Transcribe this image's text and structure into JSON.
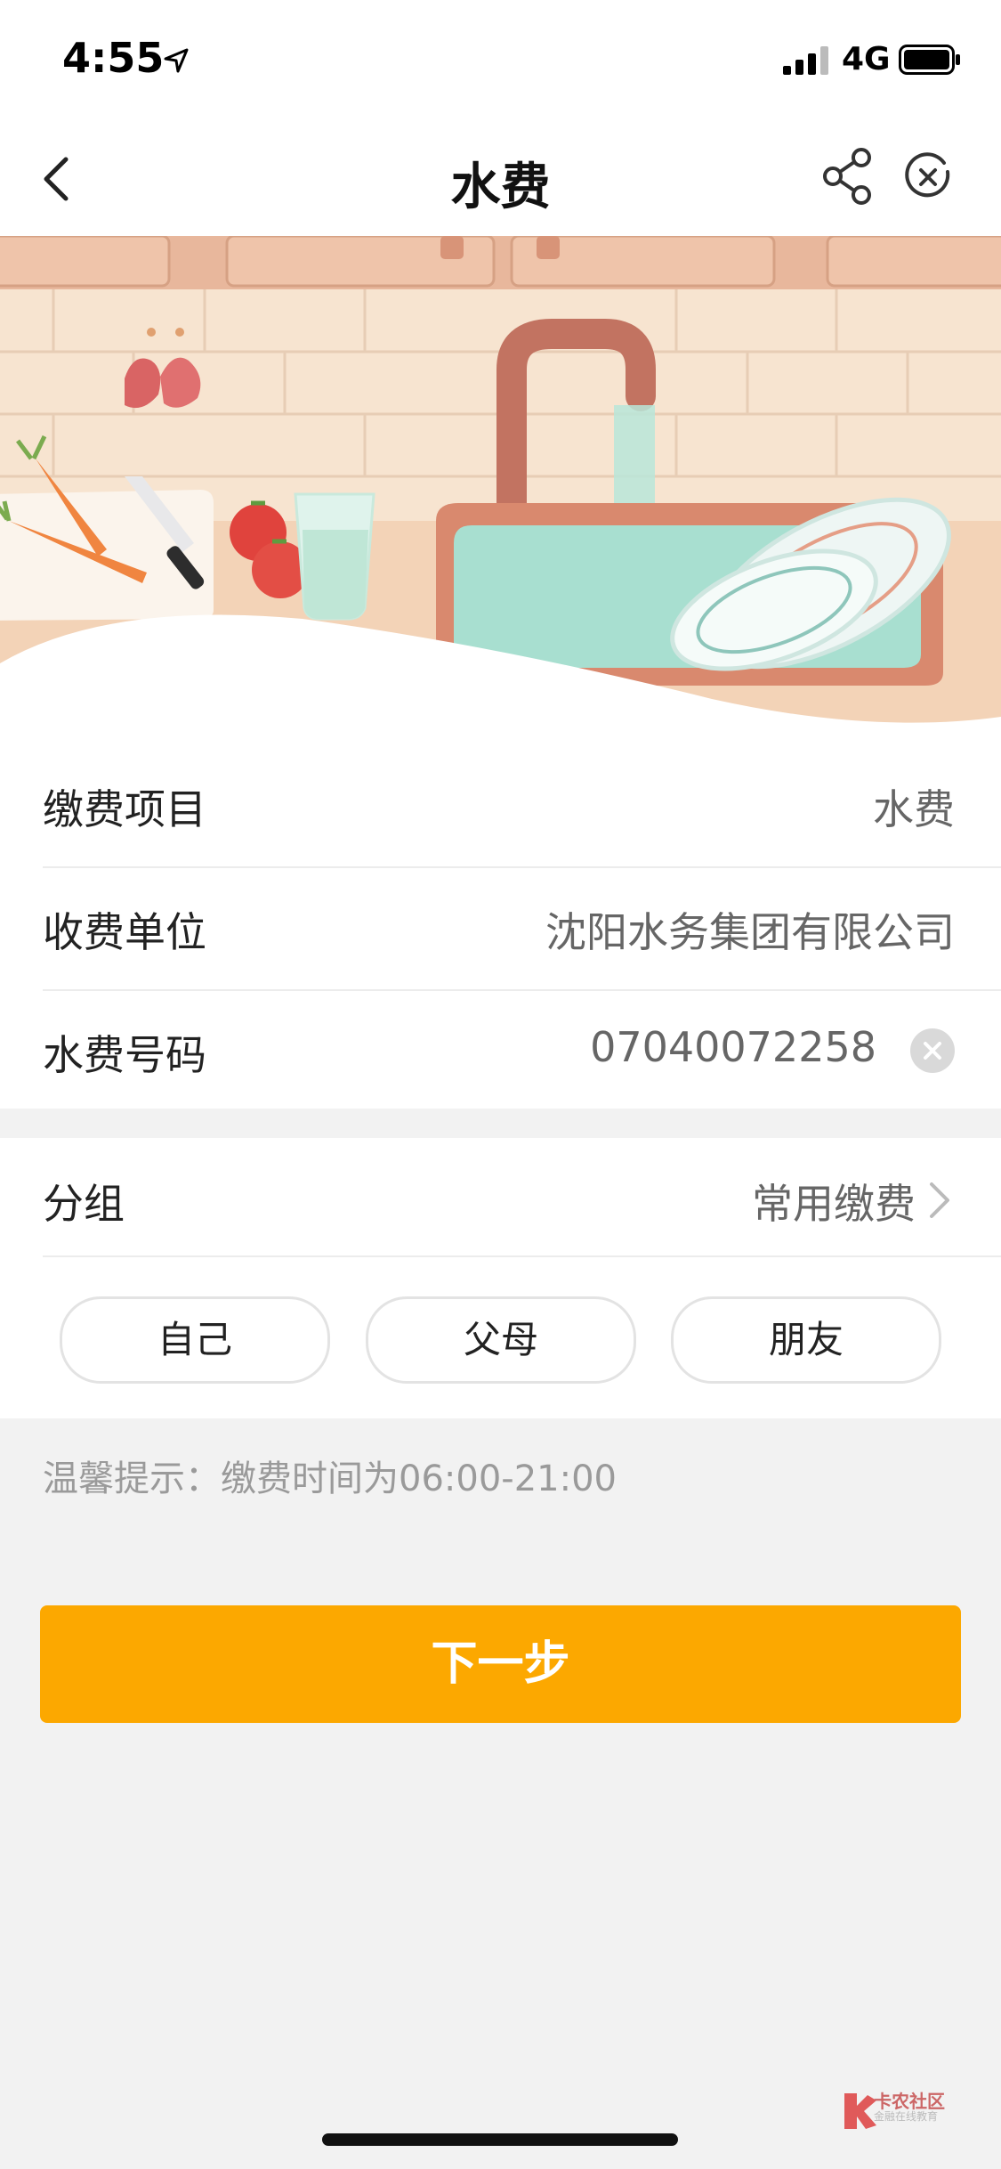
{
  "status_bar": {
    "time": "4:55",
    "network": "4G"
  },
  "nav": {
    "title": "水费"
  },
  "form": {
    "rows": [
      {
        "label": "缴费项目",
        "value": "水费"
      },
      {
        "label": "收费单位",
        "value": "沈阳水务集团有限公司"
      },
      {
        "label": "水费号码",
        "value": "07040072258"
      }
    ]
  },
  "group": {
    "label": "分组",
    "value": "常用缴费",
    "chips": [
      "自己",
      "父母",
      "朋友"
    ]
  },
  "tip": "温馨提示：缴费时间为06:00-21:00",
  "next_button": "下一步",
  "watermark": {
    "title": "卡农社区",
    "subtitle": "金融在线教育"
  },
  "colors": {
    "accent": "#fca800"
  }
}
